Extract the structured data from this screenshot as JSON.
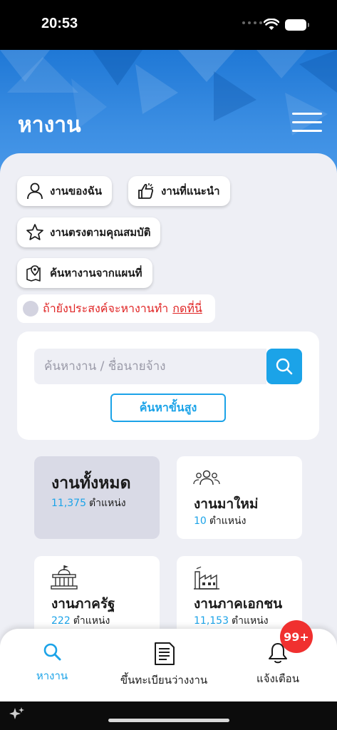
{
  "status_bar": {
    "time": "20:53"
  },
  "header": {
    "title": "หางาน"
  },
  "quick_links": {
    "my_jobs": "งานของฉัน",
    "recommended": "งานที่แนะนำ",
    "qualified": "งานตรงตามคุณสมบัติ",
    "map_search": "ค้นหางานจากแผนที่"
  },
  "wish_prompt": {
    "text": "ถ้ายังประสงค์จะหางานทำ",
    "action": "กดที่นี่"
  },
  "search": {
    "placeholder": "ค้นหางาน / ชื่อนายจ้าง",
    "advanced_label": "ค้นหาขั้นสูง"
  },
  "stats": {
    "all": {
      "title": "งานทั้งหมด",
      "count": "11,375",
      "unit": "ตำแหน่ง"
    },
    "new": {
      "title": "งานมาใหม่",
      "count": "10",
      "unit": "ตำแหน่ง"
    },
    "government": {
      "title": "งานภาครัฐ",
      "count": "222",
      "unit": "ตำแหน่ง"
    },
    "private": {
      "title": "งานภาคเอกชน",
      "count": "11,153",
      "unit": "ตำแหน่ง"
    }
  },
  "bottom_nav": {
    "find_jobs": "หางาน",
    "register": "ขึ้นทะเบียนว่างงาน",
    "notifications": "แจ้งเตือน",
    "badge": "99+"
  },
  "colors": {
    "accent": "#1ba3e8",
    "alert": "#e02424",
    "header": "#1f78d6"
  }
}
